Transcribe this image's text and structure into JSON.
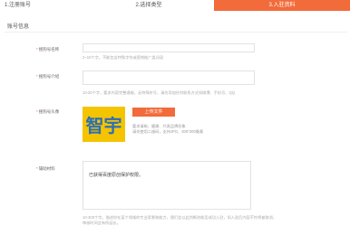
{
  "steps": [
    {
      "label": "1.注册账号",
      "active": false
    },
    {
      "label": "2.选择类型",
      "active": false
    },
    {
      "label": "3.入驻资料",
      "active": true
    }
  ],
  "colors": {
    "accent": "#f26b3a",
    "avatar_bg": "#f5c400",
    "avatar_text": "#2a6fb8"
  },
  "section_title": "账号信息",
  "fields": {
    "name": {
      "required": "*",
      "label": "搜狗号名称",
      "placeholder": "",
      "hint": "2~10个字，不能包含特殊字符或营销推广类词语"
    },
    "intro": {
      "required": "*",
      "label": "搜狗号介绍",
      "placeholder": "",
      "hint": "10-30个字，要求内容完整通顺，无特殊符号，请勿添加任何联系方式如微博、手机号、QQ"
    },
    "avatar": {
      "required": "*",
      "label": "搜狗号头像",
      "avatar_text": "智宇",
      "upload_label": "上传文件",
      "hint_lines": [
        "要求清晰、健康、代表品牌形象",
        "请勿使用二维码，支持JPG、200*200像素"
      ]
    },
    "support": {
      "required": "*",
      "label": "辅助材料",
      "value": "已获得百度原创保护权限。",
      "hint": "10-300个字，描述你在某个领域的专业背景和能力，我们会以此判断你能否成功入驻，如入驻后内容不符将被取消，审核时间会有所延长。"
    }
  }
}
